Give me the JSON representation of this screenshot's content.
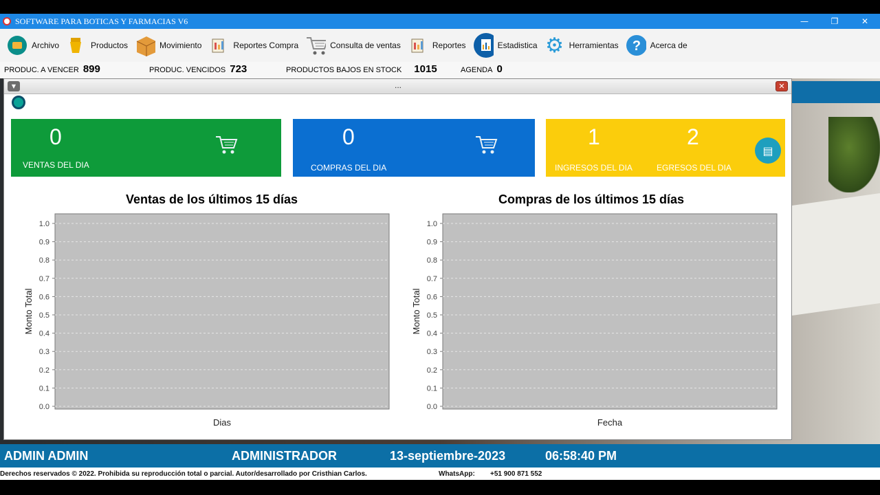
{
  "window": {
    "title": "SOFTWARE PARA BOTICAS Y FARMACIAS V6",
    "minimize": "—",
    "maximize": "❐",
    "close": "✕"
  },
  "menu": [
    {
      "label": "Archivo",
      "icon": "archive-icon",
      "glyph": "▣"
    },
    {
      "label": "Productos",
      "icon": "products-icon",
      "glyph": "⚱"
    },
    {
      "label": "Movimiento",
      "icon": "box-icon",
      "glyph": "▦"
    },
    {
      "label": "Reportes Compra",
      "icon": "report-icon",
      "glyph": "▤"
    },
    {
      "label": "Consulta de ventas",
      "icon": "cart-icon",
      "glyph": "🛒"
    },
    {
      "label": "Reportes",
      "icon": "report-icon",
      "glyph": "▤"
    },
    {
      "label": "Estadistica",
      "icon": "stats-icon",
      "glyph": "▥"
    },
    {
      "label": "Herramientas",
      "icon": "gear-icon",
      "glyph": "⚙"
    },
    {
      "label": "Acerca de",
      "icon": "help-icon",
      "glyph": "?"
    }
  ],
  "stats": {
    "vencer_label": "PRODUC. A VENCER",
    "vencer_value": "899",
    "vencidos_label": "PRODUC. VENCIDOS",
    "vencidos_value": "723",
    "bajos_label": "PRODUCTOS BAJOS EN STOCK",
    "bajos_value": "1015",
    "agenda_label": "AGENDA",
    "agenda_value": "0"
  },
  "internal_window": {
    "title": "..."
  },
  "cards": {
    "ventas_value": "0",
    "ventas_label": "VENTAS DEL DIA",
    "compras_value": "0",
    "compras_label": "COMPRAS DEL DIA",
    "ingresos_value": "1",
    "ingresos_label": "INGRESOS DEL DIA",
    "egresos_value": "2",
    "egresos_label": "EGRESOS DEL DIA"
  },
  "colors": {
    "green_card": "#0e9b3a",
    "blue_card": "#0b6fd1",
    "yellow_card": "#fbcd0c",
    "footer": "#0c6fa6",
    "plot_bg": "#c0c0c0"
  },
  "chart_data": [
    {
      "type": "bar",
      "title": "Ventas de los últimos 15 días",
      "xlabel": "Dias",
      "ylabel": "Monto Total",
      "categories": [],
      "values": [],
      "ylim": [
        0,
        1.0
      ],
      "yticks": [
        "0.0",
        "0.1",
        "0.2",
        "0.3",
        "0.4",
        "0.5",
        "0.6",
        "0.7",
        "0.8",
        "0.9",
        "1.0"
      ],
      "grid": true
    },
    {
      "type": "bar",
      "title": "Compras de los últimos 15 días",
      "xlabel": "Fecha",
      "ylabel": "Monto Total",
      "categories": [],
      "values": [],
      "ylim": [
        0,
        1.0
      ],
      "yticks": [
        "0.0",
        "0.1",
        "0.2",
        "0.3",
        "0.4",
        "0.5",
        "0.6",
        "0.7",
        "0.8",
        "0.9",
        "1.0"
      ],
      "grid": true
    }
  ],
  "footer": {
    "user": "ADMIN ADMIN",
    "role": "ADMINISTRADOR",
    "date": "13-septiembre-2023",
    "time": "06:58:40 PM"
  },
  "copyright": {
    "text": "Derechos reservados © 2022. Prohibida su reproducción total o parcial.  Autor/desarrollado por Cristhian Carlos.",
    "whatsapp_label": "WhatsApp:",
    "whatsapp_number": "+51 900 871 552"
  }
}
